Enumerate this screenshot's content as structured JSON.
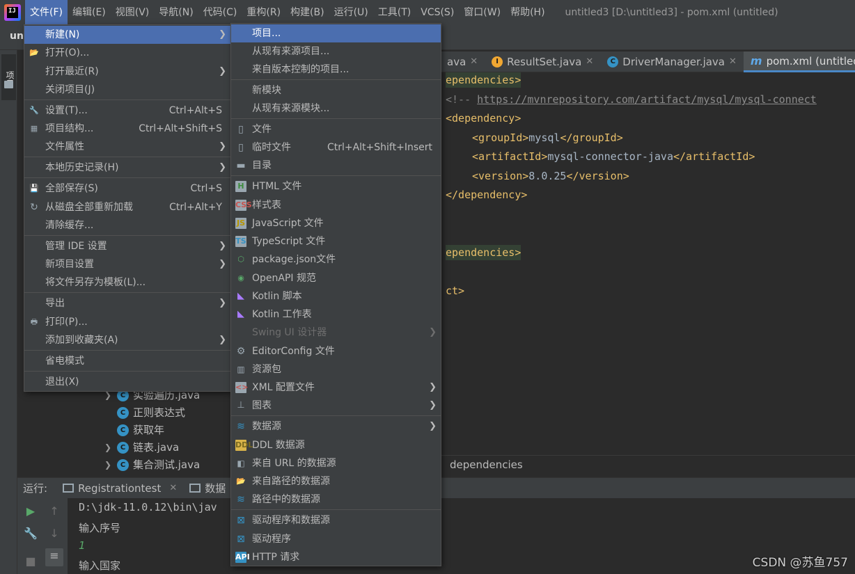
{
  "menubar": {
    "items": [
      "文件(F)",
      "编辑(E)",
      "视图(V)",
      "导航(N)",
      "代码(C)",
      "重构(R)",
      "构建(B)",
      "运行(U)",
      "工具(T)",
      "VCS(S)",
      "窗口(W)",
      "帮助(H)"
    ],
    "window_title": "untitled3 [D:\\untitled3] - pom.xml (untitled)"
  },
  "navbar": {
    "project": "unt"
  },
  "left_strip": {
    "tab": "项目"
  },
  "tabs": [
    {
      "label": "ava"
    },
    {
      "label": "ResultSet.java"
    },
    {
      "label": "DriverManager.java"
    },
    {
      "label": "pom.xml (untitled)"
    }
  ],
  "code": {
    "l1": "ependencies>",
    "l2_cmt": "<!-- ",
    "l2_url": "https://mvnrepository.com/artifact/mysql/mysql-connect",
    "l3": "<dependency>",
    "l4_open": "<groupId>",
    "l4_val": "mysql",
    "l4_close": "</groupId>",
    "l5_open": "<artifactId>",
    "l5_val": "mysql-connector-java",
    "l5_close": "</artifactId>",
    "l6_open": "<version>",
    "l6_val": "8.0.25",
    "l6_close": "</version>",
    "l7": "</dependency>",
    "l8": "ependencies>",
    "l9": "ct>"
  },
  "breadcrumb": "dependencies",
  "tree": [
    {
      "label": "实验遍历.java",
      "arrow": true
    },
    {
      "label": "正则表达式",
      "arrow": false
    },
    {
      "label": "获取年",
      "arrow": false
    },
    {
      "label": "链表.java",
      "arrow": true
    },
    {
      "label": "集合测试.java",
      "arrow": true
    }
  ],
  "run": {
    "label": "运行:",
    "tab1": "Registrationtest",
    "tab2": "数据",
    "console": [
      "D:\\jdk-11.0.12\\bin\\jav",
      "输入序号",
      "1",
      "输入国家"
    ]
  },
  "file_menu": {
    "items": [
      {
        "label": "新建(N)",
        "submenu": true,
        "selected": true
      },
      {
        "label": "打开(O)...",
        "icon": "folder-open-icon"
      },
      {
        "label": "打开最近(R)",
        "submenu": true
      },
      {
        "label": "关闭项目(J)"
      },
      {
        "label": "设置(T)...",
        "shortcut": "Ctrl+Alt+S",
        "icon": "wrench-icon"
      },
      {
        "label": "项目结构...",
        "shortcut": "Ctrl+Alt+Shift+S",
        "icon": "project-structure-icon"
      },
      {
        "label": "文件属性",
        "submenu": true
      },
      {
        "label": "本地历史记录(H)",
        "submenu": true
      },
      {
        "label": "全部保存(S)",
        "shortcut": "Ctrl+S",
        "icon": "save-icon"
      },
      {
        "label": "从磁盘全部重新加载",
        "shortcut": "Ctrl+Alt+Y",
        "icon": "reload-icon"
      },
      {
        "label": "清除缓存..."
      },
      {
        "label": "管理 IDE 设置",
        "submenu": true
      },
      {
        "label": "新项目设置",
        "submenu": true
      },
      {
        "label": "将文件另存为模板(L)..."
      },
      {
        "label": "导出",
        "submenu": true
      },
      {
        "label": "打印(P)...",
        "icon": "print-icon"
      },
      {
        "label": "添加到收藏夹(A)",
        "submenu": true
      },
      {
        "label": "省电模式"
      },
      {
        "label": "退出(X)"
      }
    ]
  },
  "new_menu": {
    "items": [
      {
        "label": "项目...",
        "selected": true
      },
      {
        "label": "从现有来源项目..."
      },
      {
        "label": "来自版本控制的项目..."
      },
      {
        "label": "新模块"
      },
      {
        "label": "从现有来源模块..."
      },
      {
        "label": "文件",
        "icon": "file-icon"
      },
      {
        "label": "临时文件",
        "shortcut": "Ctrl+Alt+Shift+Insert",
        "icon": "scratch-file-icon"
      },
      {
        "label": "目录",
        "icon": "directory-icon"
      },
      {
        "label": "HTML 文件",
        "icon": "html-file-icon"
      },
      {
        "label": "样式表",
        "icon": "css-file-icon"
      },
      {
        "label": "JavaScript 文件",
        "icon": "js-file-icon"
      },
      {
        "label": "TypeScript 文件",
        "icon": "ts-file-icon"
      },
      {
        "label": "package.json文件",
        "icon": "nodejs-icon"
      },
      {
        "label": "OpenAPI 规范",
        "icon": "openapi-icon"
      },
      {
        "label": "Kotlin 脚本",
        "icon": "kotlin-icon"
      },
      {
        "label": "Kotlin 工作表",
        "icon": "kotlin-worksheet-icon"
      },
      {
        "label": "Swing UI 设计器",
        "submenu": true,
        "disabled": true
      },
      {
        "label": "EditorConfig 文件",
        "icon": "gear-icon"
      },
      {
        "label": "资源包",
        "icon": "resource-bundle-icon"
      },
      {
        "label": "XML 配置文件",
        "submenu": true,
        "icon": "xml-file-icon"
      },
      {
        "label": "图表",
        "submenu": true,
        "icon": "diagram-icon"
      },
      {
        "label": "数据源",
        "submenu": true,
        "icon": "datasource-icon"
      },
      {
        "label": "DDL 数据源",
        "icon": "ddl-icon"
      },
      {
        "label": "来自 URL 的数据源",
        "icon": "url-datasource-icon"
      },
      {
        "label": "来自路径的数据源",
        "icon": "folder-open-icon"
      },
      {
        "label": "路径中的数据源",
        "icon": "datasource-icon"
      },
      {
        "label": "驱动程序和数据源",
        "icon": "driver-datasource-icon"
      },
      {
        "label": "驱动程序",
        "icon": "driver-icon"
      },
      {
        "label": "HTTP 请求",
        "icon": "api-icon"
      }
    ]
  },
  "watermark": "CSDN @苏鱼757"
}
